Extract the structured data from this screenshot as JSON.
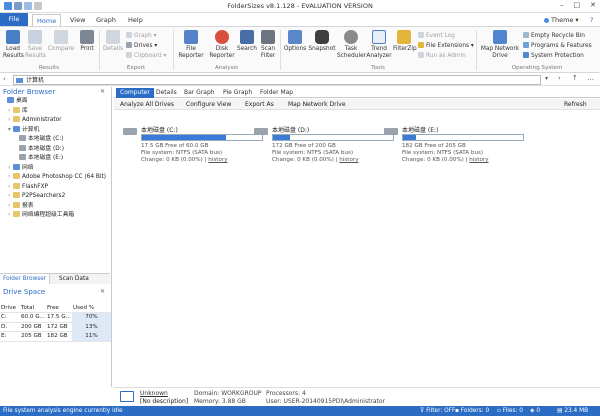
{
  "window": {
    "title": "FolderSizes v8.1.128 - EVALUATION VERSION",
    "theme_label": "Theme"
  },
  "tabs": {
    "file": "File",
    "home": "Home",
    "view": "View",
    "graph": "Graph",
    "help": "Help"
  },
  "ribbon": {
    "results_group": "Results",
    "export_group": "Export",
    "analysis_group": "Analysis",
    "tools_group": "Tools",
    "os_group": "Operating System",
    "load": "Load\nResults",
    "save": "Save\nResults",
    "compare": "Compare",
    "print": "Print",
    "details": "Details",
    "graph": "Graph",
    "drives": "Drives",
    "clipboard": "Clipboard",
    "file_reporter": "File\nReporter",
    "disk_reporter": "Disk\nReporter",
    "search": "Search",
    "scan_filter": "Scan\nFilter",
    "options": "Options",
    "snapshot": "Snapshot",
    "task_scheduler": "Task\nScheduler",
    "trend_analyzer": "Trend\nAnalyzer",
    "filezip": "FilterZip",
    "event_log": "Event Log",
    "file_extensions": "File Extensions",
    "run_as_admin": "Run as Admin",
    "map_network": "Map Network\nDrive",
    "empty_recycle": "Empty Recycle Bin",
    "programs_features": "Programs & Features",
    "system_protection": "System Protection"
  },
  "address": {
    "path": "计算机"
  },
  "sidebar": {
    "title": "Folder Browser",
    "tree": [
      {
        "label": "桌面",
        "indent": 0,
        "icon": "desktop"
      },
      {
        "label": "库",
        "indent": 1,
        "icon": "folder"
      },
      {
        "label": "Administrator",
        "indent": 1,
        "icon": "folder"
      },
      {
        "label": "计算机",
        "indent": 1,
        "icon": "computer"
      },
      {
        "label": "本地磁盘 (C:)",
        "indent": 2,
        "icon": "drive"
      },
      {
        "label": "本地磁盘 (D:)",
        "indent": 2,
        "icon": "drive"
      },
      {
        "label": "本地磁盘 (E:)",
        "indent": 2,
        "icon": "drive"
      },
      {
        "label": "网络",
        "indent": 1,
        "icon": "network"
      },
      {
        "label": "Adobe Photoshop CC (64 Bit)",
        "indent": 1,
        "icon": "folder"
      },
      {
        "label": "FlashFXP",
        "indent": 1,
        "icon": "folder"
      },
      {
        "label": "P2PSearchers2",
        "indent": 1,
        "icon": "folder"
      },
      {
        "label": "报表",
        "indent": 1,
        "icon": "folder"
      },
      {
        "label": "网络编程超级工具箱",
        "indent": 1,
        "icon": "folder"
      }
    ],
    "tabs": {
      "folder_browser": "Folder Browser",
      "scan_data": "Scan Data"
    }
  },
  "drive_space": {
    "title": "Drive Space",
    "headers": {
      "drive": "Drive",
      "total": "Total",
      "free": "Free",
      "used": "Used %"
    },
    "rows": [
      {
        "drive": "C:",
        "total": "60.0 G...",
        "free": "17.5 G...",
        "used": "70%"
      },
      {
        "drive": "D:",
        "total": "200 GB",
        "free": "172 GB",
        "used": "13%"
      },
      {
        "drive": "E:",
        "total": "205 GB",
        "free": "182 GB",
        "used": "11%"
      }
    ]
  },
  "main": {
    "tabs": {
      "computer": "Computer",
      "details": "Details",
      "bar_graph": "Bar Graph",
      "pie_graph": "Pie Graph",
      "folder_map": "Folder Map"
    },
    "toolbar": {
      "analyze": "Analyze All Drives",
      "configure": "Configure View",
      "export": "Export As",
      "map": "Map Network Drive",
      "refresh": "Refresh"
    },
    "drives": [
      {
        "name": "本地磁盘 (C:)",
        "used_fraction": 0.7,
        "free": "17.5 GB Free of 60.0 GB",
        "fs": "File system: NTFS (SATA bus)",
        "change": "Change: 0 KB (0.00%) |",
        "history": "history"
      },
      {
        "name": "本地磁盘 (D:)",
        "used_fraction": 0.14,
        "free": "172 GB Free of 200 GB",
        "fs": "File system: NTFS (SATA bus)",
        "change": "Change: 0 KB (0.00%) |",
        "history": "history"
      },
      {
        "name": "本地磁盘 (E:)",
        "used_fraction": 0.11,
        "free": "182 GB Free of 205 GB",
        "fs": "File system: NTFS (SATA bus)",
        "change": "Change: 0 KB (0.00%) |",
        "history": "history"
      }
    ]
  },
  "info": {
    "name": "Unknown",
    "desc": "[No description]",
    "domain": "Domain: WORKGROUP",
    "memory": "Memory: 3.88 GB",
    "processors": "Processors: 4",
    "user": "User: USER-20140915PDI\\Administrator"
  },
  "status": {
    "text": "File system analysis engine currently idle",
    "filter": "Filter: OFF",
    "folders": "Folders: 0",
    "files": "Files: 0",
    "items": "0",
    "mem": "23.4 MB"
  },
  "colors": {
    "accent": "#2b6cc4",
    "bar": "#3a7bd5"
  }
}
